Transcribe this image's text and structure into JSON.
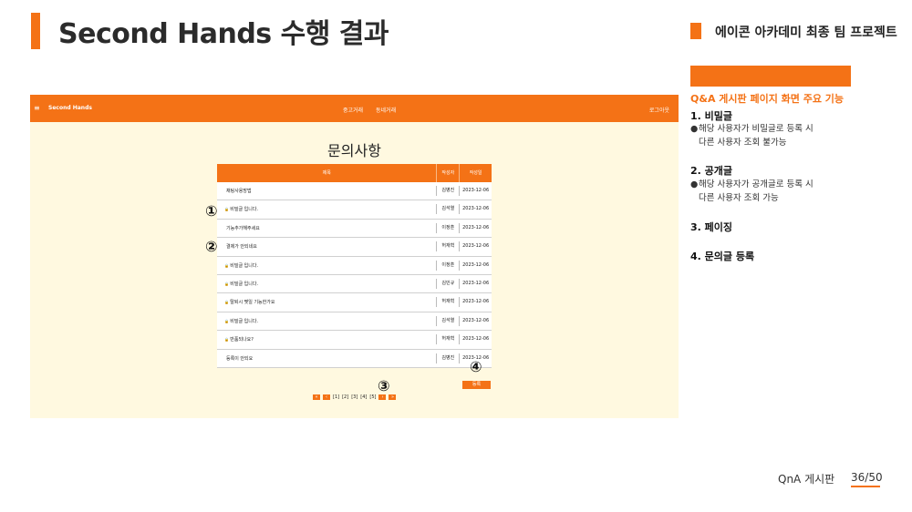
{
  "slide": {
    "title": "Second Hands 수행 결과",
    "project": "에이콘 아카데미 최종 팀 프로젝트",
    "footer_label": "QnA 게시판",
    "footer_page": "36/50"
  },
  "screenshot": {
    "nav": {
      "menu_icon": "≡",
      "brand": "Second Hands",
      "links": [
        "중고거래",
        "동네거래"
      ],
      "login": "로그아웃"
    },
    "page_title": "문의사항",
    "columns": [
      "제목",
      "작성자",
      "작성일"
    ],
    "rows": [
      {
        "title": "채팅사용방법",
        "author": "김병진",
        "date": "2023-12-06",
        "locked": false
      },
      {
        "title": "비밀글 입니다.",
        "author": "김석열",
        "date": "2023-12-06",
        "locked": true
      },
      {
        "title": "기능추가해주세요",
        "author": "이정훈",
        "date": "2023-12-06",
        "locked": false
      },
      {
        "title": "결제가 안되네요",
        "author": "허재혁",
        "date": "2023-12-06",
        "locked": false
      },
      {
        "title": "비밀글 입니다.",
        "author": "이정훈",
        "date": "2023-12-06",
        "locked": true
      },
      {
        "title": "비밀글 입니다.",
        "author": "김민규",
        "date": "2023-12-06",
        "locked": true
      },
      {
        "title": "탈퇴시 몇일 기능한가요",
        "author": "허재혁",
        "date": "2023-12-06",
        "locked": true
      },
      {
        "title": "비밀글 입니다.",
        "author": "김석열",
        "date": "2023-12-06",
        "locked": true
      },
      {
        "title": "반품되나요?",
        "author": "허재혁",
        "date": "2023-12-06",
        "locked": true
      },
      {
        "title": "등록이 안되요",
        "author": "김병진",
        "date": "2023-12-06",
        "locked": false
      }
    ],
    "register_button": "등록",
    "pager": {
      "first": "«",
      "prev": "‹",
      "pages": [
        "[1]",
        "[2]",
        "[3]",
        "[4]",
        "[5]"
      ],
      "next": "›",
      "last": "»"
    },
    "markers": [
      "①",
      "②",
      "③",
      "④"
    ]
  },
  "side": {
    "subtitle": "Q&A 게시판 페이지 화면 주요 기능",
    "items": [
      {
        "heading": "1. 비밀글",
        "bullet": "●",
        "line1": "해당 사용자가 비밀글로 등록 시",
        "line2": "다른 사용자 조회 불가능"
      },
      {
        "heading": "2. 공개글",
        "bullet": "●",
        "line1": "해당 사용자가 공개글로 등록 시",
        "line2": "다른 사용자 조회 가능"
      },
      {
        "heading": "3. 페이징"
      },
      {
        "heading": "4. 문의글 등록"
      }
    ]
  },
  "colors": {
    "accent": "#f47216",
    "screenshot_bg": "#fff9e0"
  }
}
